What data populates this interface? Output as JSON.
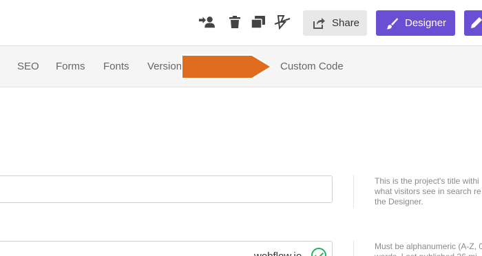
{
  "toolbar": {
    "icons": [
      "transfer-user-icon",
      "trash-icon",
      "duplicate-icon",
      "unpublish-icon"
    ],
    "share_label": "Share",
    "designer_label": "Designer",
    "accent_color": "#6a4fd4"
  },
  "tabs": [
    "SEO",
    "Forms",
    "Fonts",
    "Version",
    "Custom Code"
  ],
  "overlay": {
    "arrow_color": "#e06c20"
  },
  "form": {
    "name_field_value": "",
    "name_help": "This is the project's title withi\nwhat visitors see in search re\nthe Designer.",
    "subdomain_suffix": "webflow.io",
    "subdomain_help": "Must be alphanumeric (A-Z, 0\nwords. Last published 26 mi",
    "valid_color": "#25b35f"
  }
}
